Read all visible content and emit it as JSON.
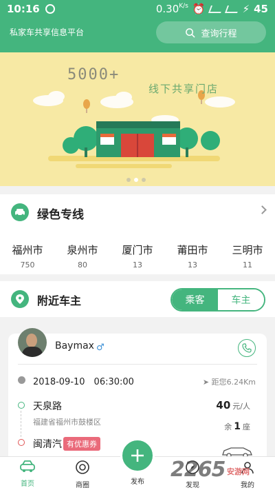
{
  "status_bar": {
    "time": "10:16",
    "speed": "0.30",
    "speed_unit": "K/s",
    "battery": "45"
  },
  "header": {
    "title": "私家车共享信息平台",
    "search_label": "查询行程"
  },
  "banner": {
    "count_text": "5000+",
    "subtitle": "线下共享门店",
    "page_count": 3,
    "active_page": 1
  },
  "green_line": {
    "title": "绿色专线",
    "cities": [
      {
        "name": "福州市",
        "count": "750"
      },
      {
        "name": "泉州市",
        "count": "80"
      },
      {
        "name": "厦门市",
        "count": "13"
      },
      {
        "name": "莆田市",
        "count": "13"
      },
      {
        "name": "三明市",
        "count": "11"
      }
    ]
  },
  "nearby": {
    "title": "附近车主",
    "toggle_passenger": "乘客",
    "toggle_owner": "车主",
    "selected": "车主"
  },
  "owner_card": {
    "name": "Baymax",
    "gender": "♂",
    "datetime": "2018-09-10　06:30:00",
    "distance": "距您6.24Km",
    "start_name": "天泉路",
    "start_address": "福建省福州市鼓楼区",
    "end_name": "闽清汽",
    "coupon": "有优惠券",
    "price": "40",
    "price_unit": "元/人",
    "seats_prefix": "余",
    "seats": "1",
    "seats_suffix": "座"
  },
  "bottom_nav": {
    "home": "首页",
    "shop": "商圈",
    "publish": "发布",
    "discover": "发现",
    "mine": "我的"
  },
  "watermark": {
    "brand": "2265",
    "sub": "安游网"
  },
  "colors": {
    "primary": "#44b57e",
    "banner_bg": "#f7e9a4",
    "coupon": "#ea6a7a"
  }
}
